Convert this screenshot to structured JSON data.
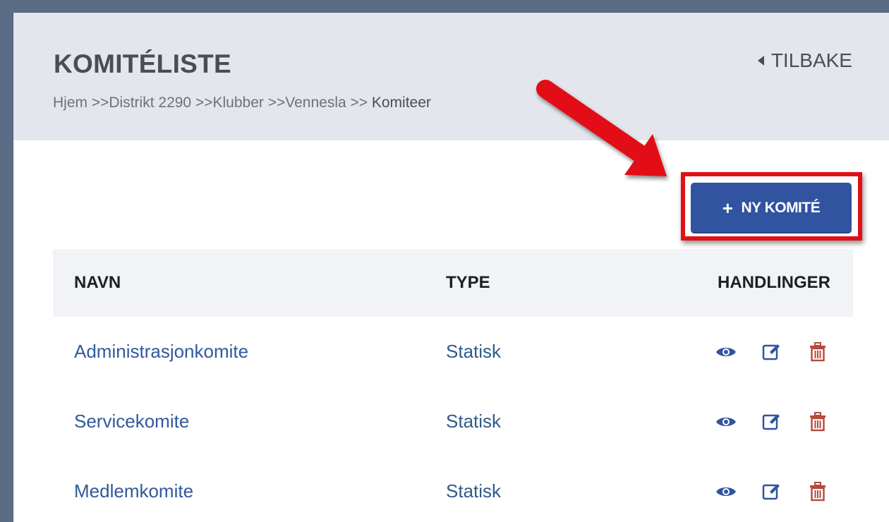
{
  "header": {
    "title": "KOMITÉLISTE",
    "back_label": "TILBAKE",
    "breadcrumb": [
      {
        "label": "Hjem"
      },
      {
        "sep": " >>"
      },
      {
        "label": "Distrikt 2290"
      },
      {
        "sep": " >>"
      },
      {
        "label": "Klubber"
      },
      {
        "sep": " >>"
      },
      {
        "label": "Vennesla"
      },
      {
        "sep": " >> "
      },
      {
        "label": "Komiteer"
      }
    ]
  },
  "toolbar": {
    "new_button_label": "NY KOMITÉ",
    "new_button_icon": "plus-icon"
  },
  "table": {
    "columns": {
      "name": "NAVN",
      "type": "TYPE",
      "actions": "HANDLINGER"
    },
    "rows": [
      {
        "name": "Administrasjonkomite",
        "type": "Statisk"
      },
      {
        "name": "Servicekomite",
        "type": "Statisk"
      },
      {
        "name": "Medlemkomite",
        "type": "Statisk"
      }
    ],
    "row_actions": [
      "eye-icon",
      "edit-icon",
      "trash-icon"
    ]
  },
  "colors": {
    "primary": "#3054a0",
    "link": "#32589c",
    "danger": "#b34a3c",
    "highlight": "#e20f16",
    "header_bg": "#e3e6ec"
  }
}
